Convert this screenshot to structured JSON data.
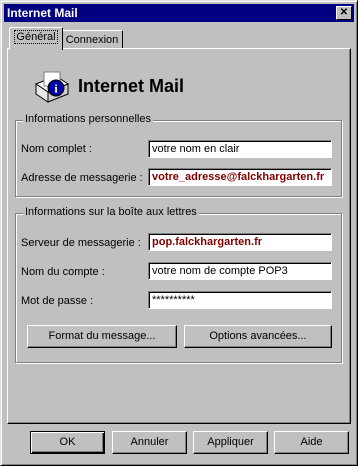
{
  "window": {
    "title": "Internet Mail",
    "close_glyph": "✕"
  },
  "tabs": [
    {
      "label": "Général",
      "active": true
    },
    {
      "label": "Connexion",
      "active": false
    }
  ],
  "header": {
    "title": "Internet Mail",
    "icon": "mail-info-icon"
  },
  "personal": {
    "legend": "Informations personnelles",
    "full_name_label": "Nom complet :",
    "full_name_value": "votre nom en clair",
    "email_label": "Adresse de messagerie :",
    "email_value": "votre_adresse@falckhargarten.fr"
  },
  "mailbox": {
    "legend": "Informations sur la boîte aux lettres",
    "server_label": "Serveur de messagerie :",
    "server_value": "pop.falckhargarten.fr",
    "account_label": "Nom du compte :",
    "account_value": "votre nom de compte POP3",
    "password_label": "Mot de passe :",
    "password_value": "**********",
    "format_button": "Format du message...",
    "advanced_button": "Options avancées..."
  },
  "footer": {
    "ok": "OK",
    "cancel": "Annuler",
    "apply": "Appliquer",
    "help": "Aide"
  },
  "colors": {
    "titlebar": "#000080",
    "highlight_text": "#800000",
    "face": "#c0c0c0"
  }
}
